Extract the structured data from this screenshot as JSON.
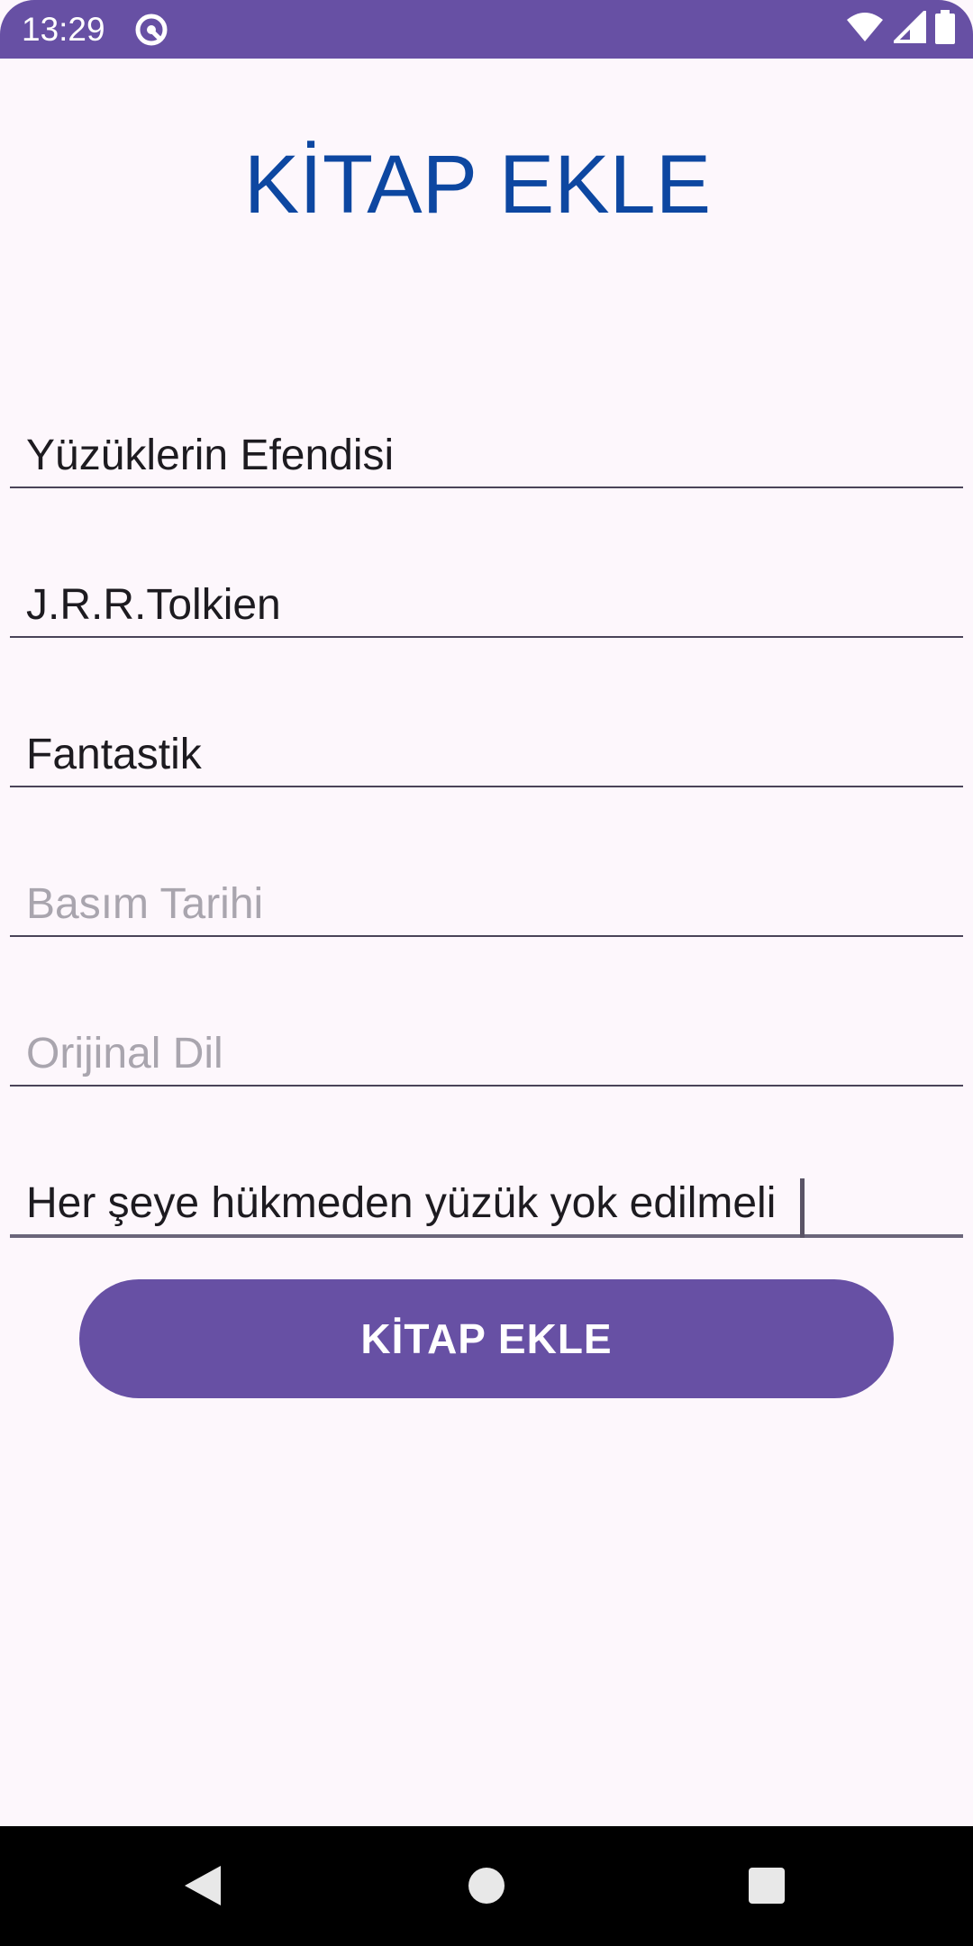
{
  "status_bar": {
    "time": "13:29",
    "icons": [
      "sync-icon",
      "wifi-icon",
      "signal-icon",
      "battery-icon"
    ]
  },
  "page": {
    "title": "KİTAP EKLE"
  },
  "form": {
    "fields": [
      {
        "name": "book-name",
        "value": "Yüzüklerin Efendisi",
        "placeholder": ""
      },
      {
        "name": "author",
        "value": "J.R.R.Tolkien",
        "placeholder": ""
      },
      {
        "name": "genre",
        "value": "Fantastik",
        "placeholder": ""
      },
      {
        "name": "publish-date",
        "value": "",
        "placeholder": "Basım Tarihi"
      },
      {
        "name": "original-language",
        "value": "",
        "placeholder": "Orijinal Dil"
      },
      {
        "name": "summary",
        "value": "Her şeye hükmeden yüzük yok edilmeli",
        "placeholder": ""
      }
    ],
    "submit_label": "KİTAP EKLE"
  },
  "nav_bar": {
    "icons": [
      "back-icon",
      "home-icon",
      "recents-icon"
    ]
  },
  "colors": {
    "accent": "#6750A4",
    "title": "#0D47A1",
    "background": "#FDF7FC"
  }
}
